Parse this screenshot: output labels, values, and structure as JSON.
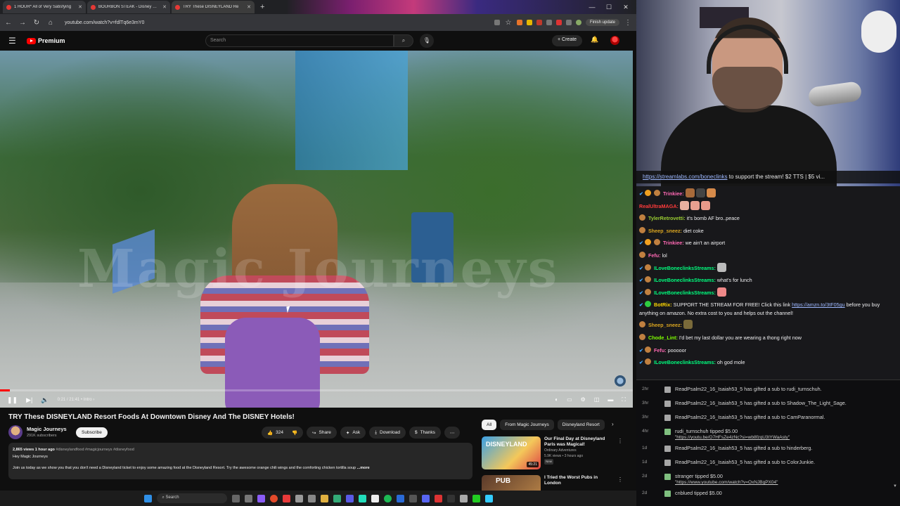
{
  "browser": {
    "tabs": [
      {
        "label": "1 HOUR* All of Very Satisfying",
        "active": false
      },
      {
        "label": "BOURBON STEAK - Disney World",
        "active": false
      },
      {
        "label": "TRY These DISNEYLAND Re",
        "active": true
      }
    ],
    "url": "youtube.com/watch?v=fdlTq6e3mY0",
    "finish_update": "Finish update"
  },
  "youtube": {
    "logo_text": "Premium",
    "search_placeholder": "Search",
    "create_label": "Create",
    "player": {
      "watermark": "Magic Journeys",
      "time": "0:21 / 21:41 • Intro ›",
      "progress": 0.016
    },
    "video": {
      "title": "TRY These DISNEYLAND Resort Foods At Downtown Disney And The DISNEY Hotels!",
      "channel": "Magic Journeys",
      "subscribers": "291K subscribers",
      "subscribe_label": "Subscribe",
      "likes": "324",
      "share_label": "Share",
      "ask_label": "Ask",
      "download_label": "Download",
      "thanks_label": "Thanks",
      "views_date": "2,865 views  1 hour ago",
      "tags": "#disneylandfood #magicjourneys #disneyfood",
      "desc_line1": "Hey Magic Journeys",
      "desc_line2": "Join us today as we show you that you don't need a Disneyland ticket to enjoy some amazing food at the Disneyland Resort. Try the awesome orange chili wings and the comforting chicken tortilla soup",
      "more_label": "...more"
    },
    "filters": [
      "All",
      "From Magic Journeys",
      "Disneyland Resort"
    ],
    "recommendations": [
      {
        "title": "Our Final Day at Disneyland Paris was Magical!",
        "channel": "Ordinary Adventures",
        "meta": "5.9K views • 3 hours ago",
        "badge": "New",
        "duration": "45:21",
        "thumb_text": "DISNEYLAND"
      },
      {
        "title": "I Tried the Worst Pubs in London",
        "channel": "",
        "meta": "",
        "badge": "",
        "duration": "",
        "thumb_text": "PUB"
      }
    ]
  },
  "taskbar": {
    "search_label": "Search"
  },
  "stream": {
    "banner_link": "https://streamlabs.com/boneclinks",
    "banner_text": " to support the stream! $2 TTS | $5 vi..."
  },
  "chat": [
    {
      "user": "Trinkiee:",
      "color": "#ff69b4",
      "text": ""
    },
    {
      "user": "RealUltraMAGA:",
      "color": "#ff3b3b",
      "text": ""
    },
    {
      "user": "TylerRetrovetti:",
      "color": "#9acd32",
      "text": "it's bomb AF bro..peace"
    },
    {
      "user": "Sheep_sneez:",
      "color": "#daa520",
      "text": "diet coke"
    },
    {
      "user": "Trinkiee:",
      "color": "#ff69b4",
      "text": "we ain't an airport"
    },
    {
      "user": "Fefu:",
      "color": "#ff69b4",
      "text": "lol"
    },
    {
      "user": "ILoveBoneclinksStreams:",
      "color": "#00ff7f",
      "text": ""
    },
    {
      "user": "ILoveBoneclinksStreams:",
      "color": "#00ff7f",
      "text": "what's for lunch"
    },
    {
      "user": "ILoveBoneclinksStreams:",
      "color": "#00ff7f",
      "text": ""
    },
    {
      "user": "BotRix:",
      "color": "#ffd700",
      "text": "SUPPORT THE STREAM FOR FREE! Click this link ",
      "link": "https://amzn.to/3tF05gu",
      "text2": " before you buy anything on amazon. No extra cost to you and helps out the channel!"
    },
    {
      "user": "Sheep_sneez:",
      "color": "#daa520",
      "text": ""
    },
    {
      "user": "Chode_Lint:",
      "color": "#7fff00",
      "text": "I'd bet my last dollar you are wearing a thong right now"
    },
    {
      "user": "Fefu:",
      "color": "#ff69b4",
      "text": "pooooor"
    },
    {
      "user": "ILoveBoneclinksStreams:",
      "color": "#00ff7f",
      "text": "oh god mole"
    }
  ],
  "events": [
    {
      "time": "2hr",
      "text": "ReadPsalm22_16_Isaiah53_5 has gifted a sub to rudi_turnschuh."
    },
    {
      "time": "3hr",
      "text": "ReadPsalm22_16_Isaiah53_5 has gifted a sub to Shadow_The_Light_Sage."
    },
    {
      "time": "3hr",
      "text": "ReadPsalm22_16_Isaiah53_5 has gifted a sub to CamParanormal."
    },
    {
      "time": "4hr",
      "text": "rudi_turnschuh tipped $5.00",
      "link": "\"https://youtu.be/O7HFsZe4zNc?si=wb8fzqU3tYWaAsty\""
    },
    {
      "time": "1d",
      "text": "ReadPsalm22_16_Isaiah53_5 has gifted a sub to hinderberg."
    },
    {
      "time": "1d",
      "text": "ReadPsalm22_16_Isaiah53_5 has gifted a sub to ColorJunkie."
    },
    {
      "time": "2d",
      "text": "stranger tipped $5.00",
      "link": "\"https://www.youtube.com/watch?v=OxNJBgPX04\""
    },
    {
      "time": "2d",
      "text": "cnblued tipped $5.00"
    }
  ]
}
